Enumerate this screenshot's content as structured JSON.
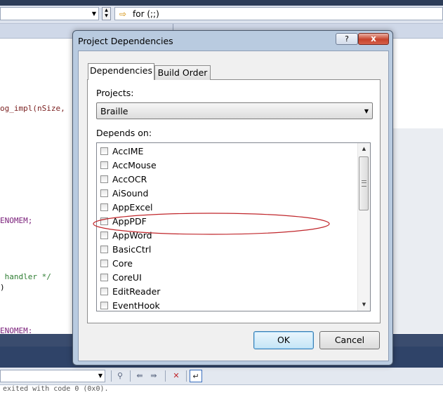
{
  "ide": {
    "function_combo": {
      "icon": "function-arrow-icon",
      "text": "for (;;)"
    },
    "code_fragments": [
      "og_impl(nSize,",
      "ENOMEM;",
      " handler */",
      ")",
      "ENOMEM;"
    ],
    "output_text": "exited with code 0 (0x0)."
  },
  "dialog": {
    "title": "Project Dependencies",
    "help_label": "?",
    "close_label": "x",
    "tabs": [
      {
        "label": "Dependencies",
        "active": true
      },
      {
        "label": "Build Order",
        "active": false
      }
    ],
    "projects_label": "Projects:",
    "selected_project": "Braille",
    "depends_on_label": "Depends on:",
    "dependencies": [
      {
        "label": "AccIME",
        "checked": false
      },
      {
        "label": "AccMouse",
        "checked": false
      },
      {
        "label": "AccOCR",
        "checked": false
      },
      {
        "label": "AiSound",
        "checked": false
      },
      {
        "label": "AppExcel",
        "checked": false
      },
      {
        "label": "AppPDF",
        "checked": false
      },
      {
        "label": "AppWord",
        "checked": false
      },
      {
        "label": "BasicCtrl",
        "checked": false
      },
      {
        "label": "Core",
        "checked": false
      },
      {
        "label": "CoreUI",
        "checked": false
      },
      {
        "label": "EditReader",
        "checked": false
      },
      {
        "label": "EventHook",
        "checked": false
      }
    ],
    "ok_label": "OK",
    "cancel_label": "Cancel",
    "annotation_color": "#c0262b"
  }
}
